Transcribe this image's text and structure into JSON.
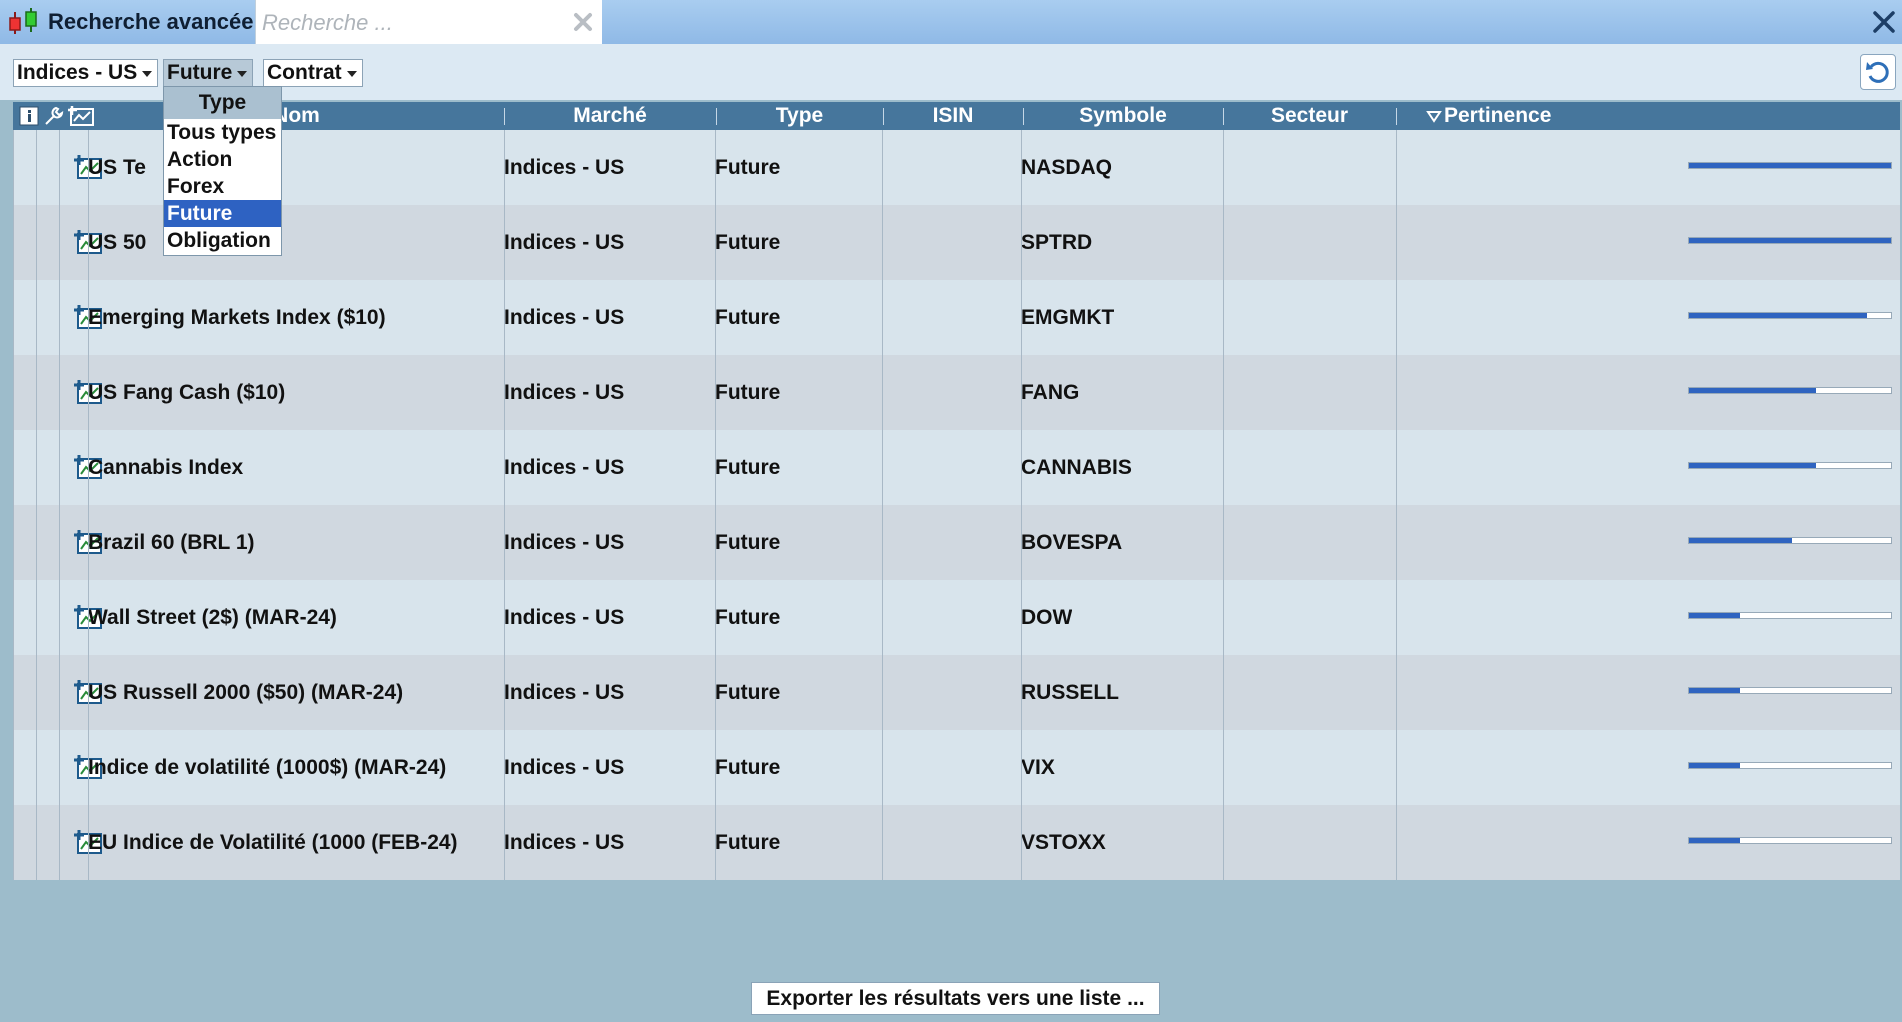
{
  "window": {
    "title": "Recherche avancée"
  },
  "search": {
    "placeholder": "Recherche ...",
    "value": ""
  },
  "filters": {
    "market": "Indices - US",
    "type": "Future",
    "contract": "Contrat"
  },
  "type_menu": {
    "header": "Type",
    "items": [
      "Tous types",
      "Action",
      "Forex",
      "Future",
      "Obligation"
    ],
    "selected": "Future"
  },
  "table": {
    "columns": [
      "Nom",
      "Marché",
      "Type",
      "ISIN",
      "Symbole",
      "Secteur",
      "Pertinence"
    ],
    "sort_column": "Pertinence",
    "sort_direction": "descending",
    "rows": [
      {
        "nom": "US Tech 100 Cash",
        "visible_nom": [
          "US Te",
          "h"
        ],
        "marche": "Indices - US",
        "type": "Future",
        "isin": "",
        "symbole": "NASDAQ",
        "secteur": "",
        "pertinence": 1.0
      },
      {
        "nom": "US 500",
        "visible_nom": [
          "US 50",
          ""
        ],
        "marche": "Indices - US",
        "type": "Future",
        "isin": "",
        "symbole": "SPTRD",
        "secteur": "",
        "pertinence": 1.0
      },
      {
        "nom": "Emerging Markets Index ($10)",
        "marche": "Indices - US",
        "type": "Future",
        "isin": "",
        "symbole": "EMGMKT",
        "secteur": "",
        "pertinence": 0.88
      },
      {
        "nom": "US Fang Cash ($10)",
        "marche": "Indices - US",
        "type": "Future",
        "isin": "",
        "symbole": "FANG",
        "secteur": "",
        "pertinence": 0.63
      },
      {
        "nom": "Cannabis Index",
        "marche": "Indices - US",
        "type": "Future",
        "isin": "",
        "symbole": "CANNABIS",
        "secteur": "",
        "pertinence": 0.63
      },
      {
        "nom": "Brazil 60 (BRL 1)",
        "marche": "Indices - US",
        "type": "Future",
        "isin": "",
        "symbole": "BOVESPA",
        "secteur": "",
        "pertinence": 0.51
      },
      {
        "nom": "Wall Street (2$) (MAR-24)",
        "marche": "Indices - US",
        "type": "Future",
        "isin": "",
        "symbole": "DOW",
        "secteur": "",
        "pertinence": 0.25
      },
      {
        "nom": "US Russell 2000 ($50) (MAR-24)",
        "marche": "Indices - US",
        "type": "Future",
        "isin": "",
        "symbole": "RUSSELL",
        "secteur": "",
        "pertinence": 0.25
      },
      {
        "nom": "Indice de volatilité (1000$) (MAR-24)",
        "marche": "Indices - US",
        "type": "Future",
        "isin": "",
        "symbole": "VIX",
        "secteur": "",
        "pertinence": 0.25
      },
      {
        "nom": "EU Indice de Volatilité (1000 (FEB-24)",
        "marche": "Indices - US",
        "type": "Future",
        "isin": "",
        "symbole": "VSTOXX",
        "secteur": "",
        "pertinence": 0.25
      }
    ]
  },
  "export": {
    "label": "Exporter les résultats vers une liste ..."
  },
  "colors": {
    "background": "#9dbccb",
    "header": "#46769c",
    "accent": "#2f64c0",
    "row_odd": "#d8e4ec",
    "row_even": "#d0d8e0"
  },
  "icons": {
    "logo": "candlestick-chart-icon",
    "clear": "clear-x-icon",
    "close": "close-x-icon",
    "refresh": "refresh-icon",
    "info": "info-icon",
    "tools": "wrench-icon",
    "add_chart": "add-chart-icon"
  }
}
